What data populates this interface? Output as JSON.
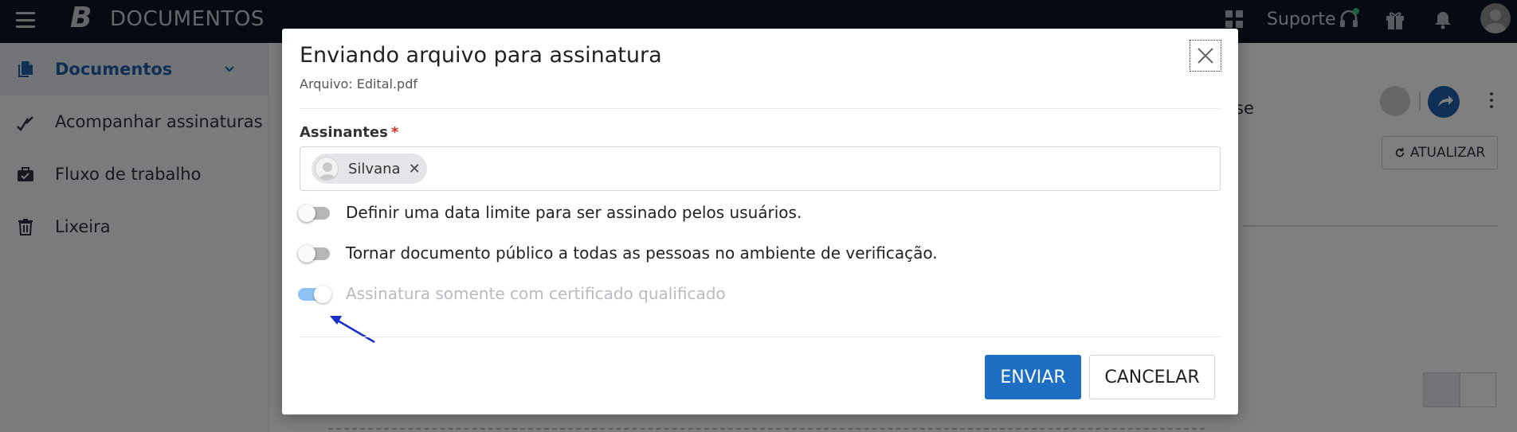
{
  "header": {
    "logo_letter": "B",
    "app_title": "DOCUMENTOS",
    "support_label": "Suporte"
  },
  "sidebar": {
    "items": [
      {
        "label": "Documentos",
        "icon": "documents-icon",
        "active": true
      },
      {
        "label": "Acompanhar assinaturas",
        "icon": "signature-check-icon"
      },
      {
        "label": "Fluxo de trabalho",
        "icon": "briefcase-icon"
      },
      {
        "label": "Lixeira",
        "icon": "trash-icon"
      }
    ]
  },
  "background": {
    "partial_text": "se",
    "refresh_label": "ATUALIZAR"
  },
  "modal": {
    "title": "Enviando arquivo para assinatura",
    "subtitle": "Arquivo: Edital.pdf",
    "signers_label": "Assinantes",
    "required_mark": "*",
    "signers": [
      {
        "name": "Silvana"
      }
    ],
    "options": [
      {
        "label": "Definir uma data limite para ser assinado pelos usuários.",
        "checked": false,
        "disabled": false
      },
      {
        "label": "Tornar documento público a todas as pessoas no ambiente de verificação.",
        "checked": false,
        "disabled": false
      },
      {
        "label": "Assinatura somente com certificado qualificado",
        "checked": true,
        "disabled": true
      }
    ],
    "send_label": "ENVIAR",
    "cancel_label": "CANCELAR"
  },
  "colors": {
    "topbar": "#0d1726",
    "primary": "#1e6fc4",
    "annotation_arrow": "#1a2ec9"
  }
}
